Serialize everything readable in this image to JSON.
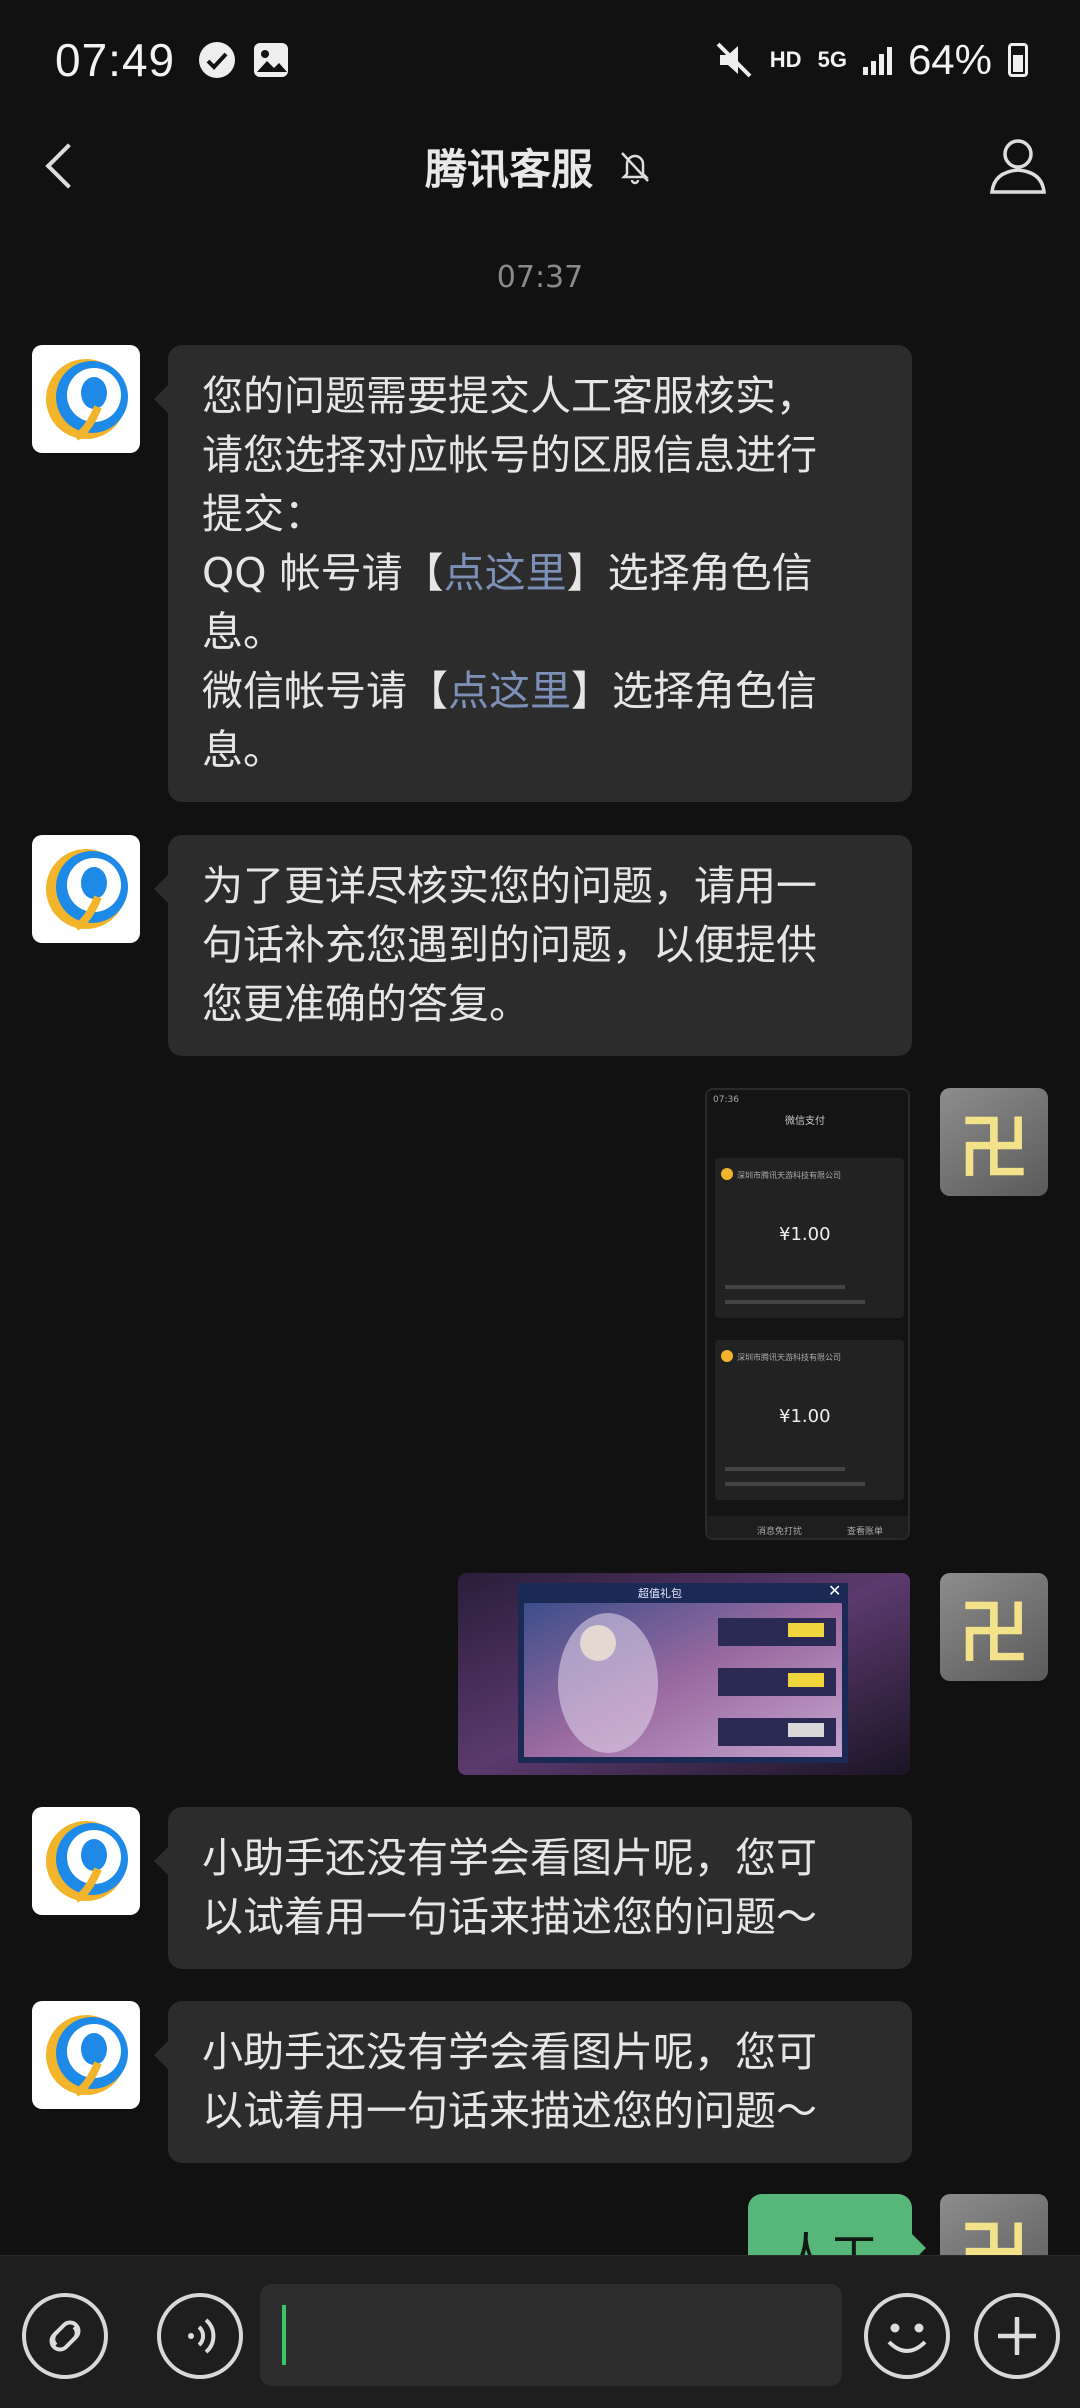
{
  "status_bar": {
    "time": "07:49",
    "network": "HD",
    "network_type": "5G",
    "battery": "64%"
  },
  "header": {
    "title": "腾讯客服"
  },
  "chat": {
    "timestamp": "07:37",
    "messages": [
      {
        "sender": "bot",
        "line1": "您的问题需要提交人工客服核实，",
        "line2": "请您选择对应帐号的区服信息进行",
        "line3": "提交：",
        "qq_prefix": "QQ 帐号请【",
        "qq_link": "点这里",
        "qq_suffix": "】选择角色信",
        "qq_suffix2": "息。",
        "wx_prefix": "微信帐号请【",
        "wx_link": "点这里",
        "wx_suffix": "】选择角色信",
        "wx_suffix2": "息。"
      },
      {
        "sender": "bot",
        "line1": "为了更详尽核实您的问题，请用一",
        "line2": "句话补充您遇到的问题，以便提供",
        "line3": "您更准确的答复。"
      },
      {
        "sender": "user",
        "type": "image",
        "screenshot": {
          "time": "07:36",
          "title": "微信支付",
          "merchant": "深圳市腾讯天游科技有限公司",
          "amount": "¥1.00",
          "amount2": "¥1.00",
          "footer_left": "消息免打扰",
          "footer_right": "查看账单"
        }
      },
      {
        "sender": "user",
        "type": "image",
        "screenshot": {
          "title": "超值礼包"
        }
      },
      {
        "sender": "bot",
        "line1": "小助手还没有学会看图片呢，您可",
        "line2": "以试着用一句话来描述您的问题～"
      },
      {
        "sender": "bot",
        "line1": "小助手还没有学会看图片呢，您可",
        "line2": "以试着用一句话来描述您的问题～"
      },
      {
        "sender": "user",
        "text": "人工"
      }
    ]
  },
  "user_avatar_glyph": "卍",
  "colors": {
    "background": "#111111",
    "bubble_left": "#2c2c2c",
    "bubble_right": "#57b77b",
    "link": "#7d90b8",
    "cursor": "#3cc568"
  }
}
